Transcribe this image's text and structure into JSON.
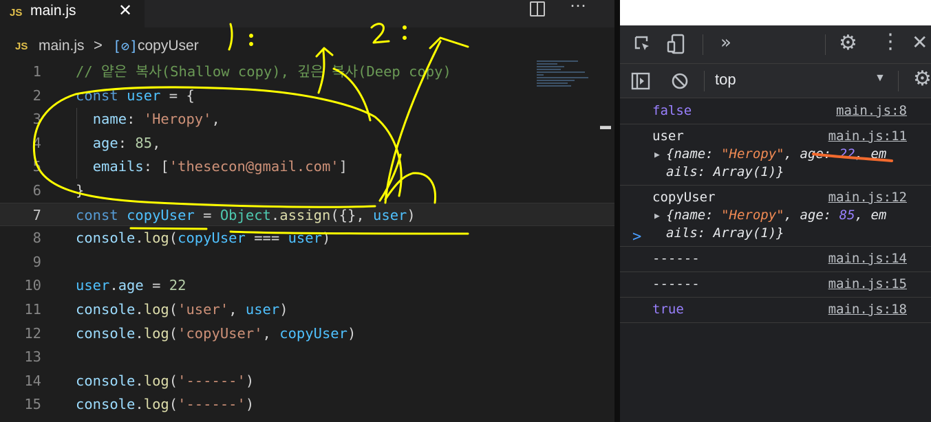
{
  "editor": {
    "tab": {
      "badge": "JS",
      "label": "main.js",
      "close": "✕"
    },
    "breadcrumb": {
      "badge": "JS",
      "file": "main.js",
      "separator": ">",
      "symbol_icon": "symbol-variable-icon",
      "symbol": "copyUser"
    },
    "current_line": 7,
    "lines": [
      {
        "n": "1",
        "tokens": [
          [
            "cm",
            "// 얕은 복사(Shallow copy), 깊은 복사(Deep copy)"
          ]
        ]
      },
      {
        "n": "2",
        "tokens": [
          [
            "kw",
            "const "
          ],
          [
            "var",
            "user"
          ],
          [
            "plain",
            " = {"
          ]
        ]
      },
      {
        "n": "3",
        "tokens": [
          [
            "plain",
            "  "
          ],
          [
            "prop",
            "name"
          ],
          [
            "plain",
            ": "
          ],
          [
            "str",
            "'Heropy'"
          ],
          [
            "plain",
            ","
          ]
        ]
      },
      {
        "n": "4",
        "tokens": [
          [
            "plain",
            "  "
          ],
          [
            "prop",
            "age"
          ],
          [
            "plain",
            ": "
          ],
          [
            "num",
            "85"
          ],
          [
            "plain",
            ","
          ]
        ]
      },
      {
        "n": "5",
        "tokens": [
          [
            "plain",
            "  "
          ],
          [
            "prop",
            "emails"
          ],
          [
            "plain",
            ": ["
          ],
          [
            "str",
            "'thesecon@gmail.com'"
          ],
          [
            "plain",
            "]"
          ]
        ]
      },
      {
        "n": "6",
        "tokens": [
          [
            "plain",
            "}"
          ]
        ]
      },
      {
        "n": "7",
        "tokens": [
          [
            "kw",
            "const "
          ],
          [
            "var",
            "copyUser"
          ],
          [
            "plain",
            " = "
          ],
          [
            "cls",
            "Object"
          ],
          [
            "plain",
            "."
          ],
          [
            "fn",
            "assign"
          ],
          [
            "plain",
            "({}, "
          ],
          [
            "var",
            "user"
          ],
          [
            "plain",
            ")"
          ]
        ]
      },
      {
        "n": "8",
        "tokens": [
          [
            "prop",
            "console"
          ],
          [
            "plain",
            "."
          ],
          [
            "fn",
            "log"
          ],
          [
            "plain",
            "("
          ],
          [
            "var",
            "copyUser"
          ],
          [
            "plain",
            " === "
          ],
          [
            "var",
            "user"
          ],
          [
            "plain",
            ")"
          ]
        ]
      },
      {
        "n": "9",
        "tokens": []
      },
      {
        "n": "10",
        "tokens": [
          [
            "var",
            "user"
          ],
          [
            "plain",
            "."
          ],
          [
            "prop",
            "age"
          ],
          [
            "plain",
            " = "
          ],
          [
            "num",
            "22"
          ]
        ]
      },
      {
        "n": "11",
        "tokens": [
          [
            "prop",
            "console"
          ],
          [
            "plain",
            "."
          ],
          [
            "fn",
            "log"
          ],
          [
            "plain",
            "("
          ],
          [
            "str",
            "'user'"
          ],
          [
            "plain",
            ", "
          ],
          [
            "var",
            "user"
          ],
          [
            "plain",
            ")"
          ]
        ]
      },
      {
        "n": "12",
        "tokens": [
          [
            "prop",
            "console"
          ],
          [
            "plain",
            "."
          ],
          [
            "fn",
            "log"
          ],
          [
            "plain",
            "("
          ],
          [
            "str",
            "'copyUser'"
          ],
          [
            "plain",
            ", "
          ],
          [
            "var",
            "copyUser"
          ],
          [
            "plain",
            ")"
          ]
        ]
      },
      {
        "n": "13",
        "tokens": []
      },
      {
        "n": "14",
        "tokens": [
          [
            "prop",
            "console"
          ],
          [
            "plain",
            "."
          ],
          [
            "fn",
            "log"
          ],
          [
            "plain",
            "("
          ],
          [
            "str",
            "'------'"
          ],
          [
            "plain",
            ")"
          ]
        ]
      },
      {
        "n": "15",
        "tokens": [
          [
            "prop",
            "console"
          ],
          [
            "plain",
            "."
          ],
          [
            "fn",
            "log"
          ],
          [
            "plain",
            "("
          ],
          [
            "str",
            "'------'"
          ],
          [
            "plain",
            ")"
          ]
        ]
      }
    ],
    "annotations": {
      "label1": "1:",
      "label2": "2:"
    }
  },
  "devtools": {
    "toolbar": {
      "more_tabs": "»",
      "context": "top"
    },
    "console": {
      "messages": [
        {
          "text": "false",
          "source": "main.js:8"
        },
        {
          "text": "user",
          "source": "main.js:11",
          "object": {
            "name": "\"Heropy\"",
            "age": "22",
            "tail": "ails: Array(1)}"
          }
        },
        {
          "text": "copyUser",
          "source": "main.js:12",
          "object": {
            "name": "\"Heropy\"",
            "age": "85",
            "tail": "ails: Array(1)}"
          }
        },
        {
          "text": "------",
          "source": "main.js:14"
        },
        {
          "text": "------",
          "source": "main.js:15"
        },
        {
          "text": "true",
          "source": "main.js:18"
        }
      ],
      "prompt": ">"
    }
  }
}
